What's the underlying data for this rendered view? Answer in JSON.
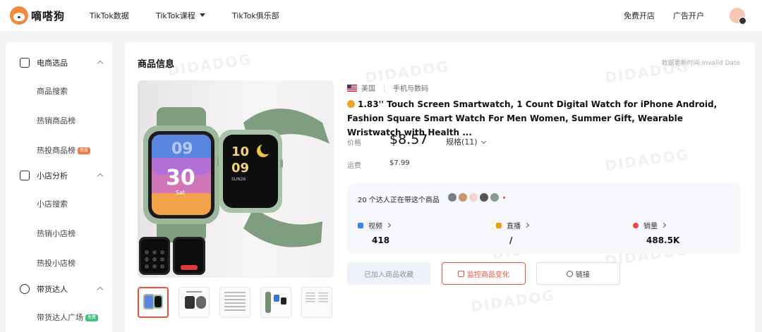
{
  "brand": {
    "name": "嘀嗒狗"
  },
  "nav": {
    "items": [
      "TikTok数据",
      "TikTok课程",
      "TikTok俱乐部"
    ],
    "right": [
      "免费开店",
      "广告开户"
    ]
  },
  "sidebar": {
    "groups": [
      {
        "label": "电商选品",
        "icon": "cart-icon",
        "items": [
          "商品搜索",
          "热销商品榜",
          "热投商品榜"
        ]
      },
      {
        "label": "小店分析",
        "icon": "shop-icon",
        "items": [
          "小店搜索",
          "热销小店榜",
          "热投小店榜"
        ]
      },
      {
        "label": "带货达人",
        "icon": "user-icon",
        "items": [
          "带货达人广场"
        ]
      }
    ],
    "badge_hot": "热投",
    "badge_new": "免费",
    "badge_hot_color": "#f07a4a",
    "badge_new_color": "#3fbf7f"
  },
  "product": {
    "section_title": "商品信息",
    "update_time": "数据更新时间:Invalid Date",
    "region": "美国",
    "category": "手机与数码",
    "title": "1.83'' Touch Screen Smartwatch, 1 Count Digital Watch for iPhone Android, Fashion Square Smart Watch For Men Women, Summer Gift, Wearable Wristwatch with Health ...",
    "price_label": "价格",
    "price": "$8.57",
    "spec": "规格(11)",
    "shipping_label": "运费",
    "shipping": "$7.99",
    "watch_screen": {
      "time_h": "09",
      "time_m": "30",
      "day": "Sat",
      "time2_h": "10",
      "time2_m": "09",
      "date2": "SUN26"
    }
  },
  "stats": {
    "creators_text": "20 个达人正在带这个商品",
    "video_label": "视频",
    "video_value": "418",
    "live_label": "直播",
    "live_value": "/",
    "sales_label": "销量",
    "sales_value": "488.5K"
  },
  "buttons": {
    "favorite": "已加入商品收藏",
    "monitor": "监控商品变化",
    "link": "链接"
  },
  "watermark_text": "DIDADOG",
  "colors": {
    "accent": "#e8533a",
    "watch_green": "#7fa07f"
  }
}
